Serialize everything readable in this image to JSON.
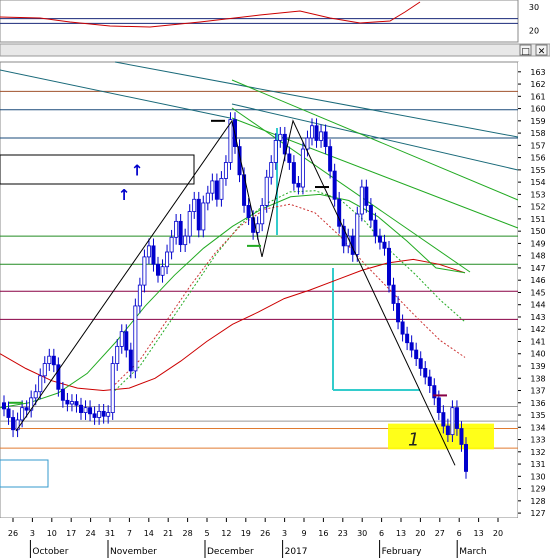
{
  "osc_panel": {
    "ticks": [
      30,
      20
    ],
    "levels": [
      25,
      23
    ],
    "line_color": "#cc0000"
  },
  "window_controls": [
    "□",
    "✕"
  ],
  "chart_data": {
    "type": "candlestick",
    "ylim": [
      126.6,
      163.8
    ],
    "y_ticks": [
      163,
      162,
      161,
      160,
      159,
      158,
      157,
      156,
      155,
      154,
      153,
      152,
      151,
      150,
      149,
      148,
      147,
      146,
      145,
      144,
      143,
      142,
      141,
      140,
      139,
      138,
      137,
      136,
      135,
      134,
      133,
      132,
      131,
      130,
      129,
      128,
      127
    ],
    "x_tick_labels": [
      "26",
      "3",
      "10",
      "17",
      "24",
      "31",
      "7",
      "14",
      "21",
      "28",
      "5",
      "12",
      "19",
      "26",
      "3",
      "9",
      "16",
      "23",
      "30",
      "6",
      "13",
      "20",
      "27",
      "6",
      "13",
      "20"
    ],
    "month_labels": [
      {
        "label": "October",
        "at": "3"
      },
      {
        "label": "November",
        "at": "31"
      },
      {
        "label": "December",
        "at": "5"
      },
      {
        "label": "2017",
        "at": "3"
      },
      {
        "label": "February",
        "at": "6"
      },
      {
        "label": "March",
        "at": "6"
      }
    ],
    "candles_close": [
      135.5,
      134.8,
      133.8,
      134.6,
      135.6,
      135.4,
      136.4,
      136.9,
      138.2,
      139.2,
      139.8,
      139.1,
      137.1,
      136.2,
      135.9,
      136.1,
      135.8,
      135.2,
      135.6,
      135.1,
      134.8,
      135.3,
      134.9,
      135.2,
      139.2,
      140.6,
      141.8,
      140.3,
      138.6,
      143.9,
      145.6,
      147.9,
      148.8,
      147.3,
      146.4,
      147.1,
      148.3,
      149.5,
      150.8,
      148.9,
      149.6,
      151.6,
      152.6,
      150.1,
      152.3,
      153.1,
      154.1,
      152.6,
      154.3,
      155.6,
      159.1,
      156.9,
      154.6,
      152.1,
      151.1,
      149.9,
      150.6,
      152.1,
      154.4,
      155.6,
      157.4,
      157.9,
      156.3,
      155.6,
      153.9,
      153.6,
      156.7,
      157.6,
      158.6,
      157.4,
      158.1,
      156.9,
      154.9,
      152.6,
      150.4,
      148.8,
      149.6,
      148.1,
      151.4,
      153.6,
      152.1,
      150.9,
      149.6,
      149.1,
      148.6,
      145.6,
      144.1,
      142.6,
      141.6,
      140.9,
      140.3,
      139.6,
      138.8,
      138.1,
      137.4,
      136.4,
      135.2,
      134.1,
      133.4,
      135.6,
      133.9,
      132.6,
      130.4
    ],
    "moving_averages": [
      {
        "color": "#cc0000",
        "style": "solid",
        "values": [
          140,
          138.8,
          137.8,
          137.2,
          137,
          137.2,
          138,
          139.4,
          141,
          142.4,
          143.4,
          144.5,
          145.2,
          146,
          146.8,
          147.4,
          147.7,
          147.3,
          146.6
        ]
      },
      {
        "color": "#22aa22",
        "style": "solid",
        "values": [
          135.6,
          136,
          136.8,
          138.4,
          141,
          143.9,
          146.4,
          148.6,
          150.4,
          151.8,
          152.8,
          153,
          152.5,
          151.2,
          149.2,
          147,
          146.6
        ]
      },
      {
        "color": "#22aa22",
        "style": "dashed",
        "values": [
          137,
          139,
          142,
          145,
          148,
          150.5,
          152.2,
          153.2,
          153.3,
          152.6,
          150.8,
          148.4,
          146.5,
          144.4,
          142.6
        ]
      },
      {
        "color": "#cc3333",
        "style": "dashed",
        "values": [
          137.5,
          139.5,
          142.5,
          145.5,
          148.2,
          150.4,
          151.8,
          152.2,
          151.5,
          149.6,
          147.3,
          145.2,
          143.1,
          141.1,
          139.7
        ]
      }
    ],
    "horizontal_levels": [
      {
        "value": 161.4,
        "color": "#a0522d"
      },
      {
        "value": 159.9,
        "color": "#1a4a7a"
      },
      {
        "value": 157.6,
        "color": "#1a4a7a"
      },
      {
        "value": 149.6,
        "color": "#228b22"
      },
      {
        "value": 147.3,
        "color": "#228b22"
      },
      {
        "value": 145.1,
        "color": "#880044"
      },
      {
        "value": 142.8,
        "color": "#880044"
      },
      {
        "value": 135.7,
        "color": "#999999"
      },
      {
        "value": 134.5,
        "color": "#999999"
      },
      {
        "value": 133.9,
        "color": "#e07b30"
      },
      {
        "value": 132.3,
        "color": "#e07b30"
      }
    ],
    "zigzag_points": [
      [
        133.7,
        0
      ],
      [
        159.0,
        1
      ],
      [
        147.9,
        2
      ],
      [
        159.0,
        3
      ],
      [
        130.9,
        4
      ]
    ],
    "highlight": {
      "label": "1",
      "color": "#ffff00",
      "y_range": [
        132.2,
        134.3
      ]
    },
    "up_arrows": [
      "↑",
      "↑"
    ]
  }
}
